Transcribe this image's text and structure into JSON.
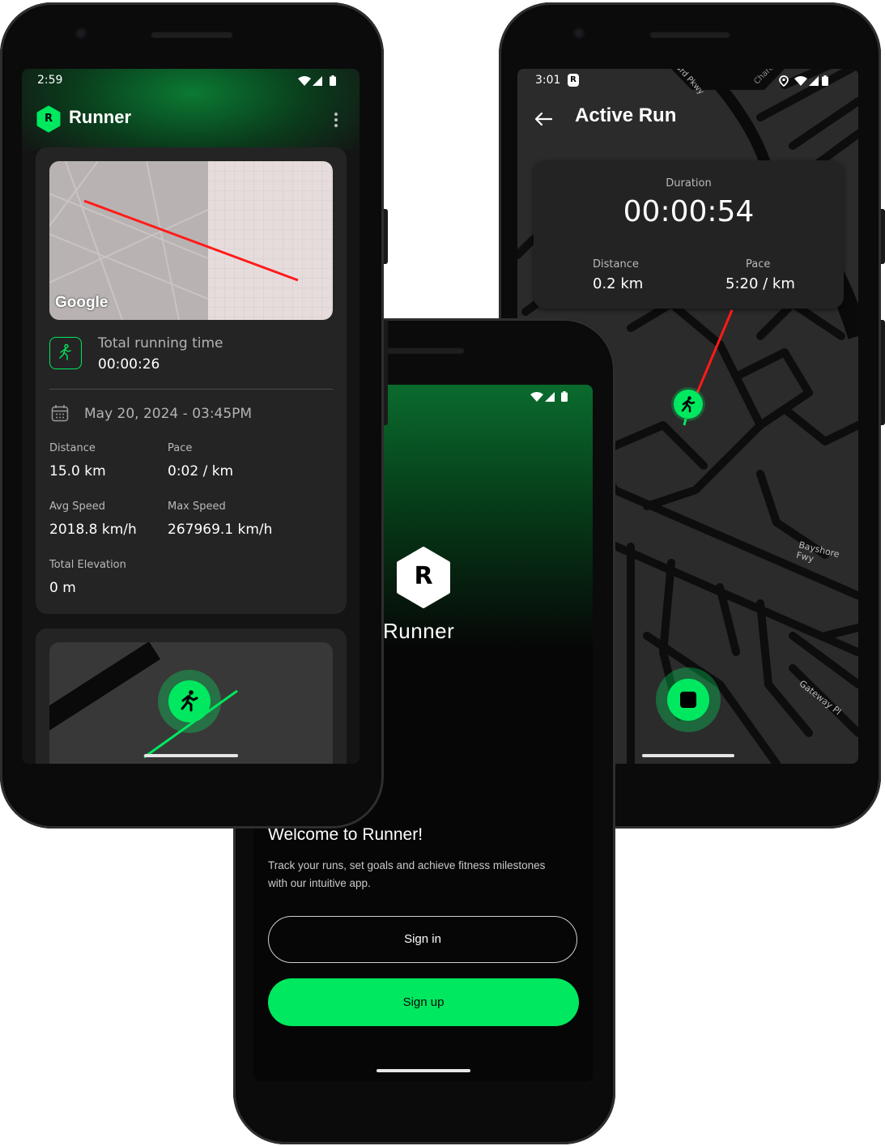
{
  "colors": {
    "accent": "#00e85f",
    "card": "#242424",
    "screen_bg": "#141414",
    "route": "#ff1a1a"
  },
  "home": {
    "status_time": "2:59",
    "app_title": "Runner",
    "logo_letter": "R",
    "map_provider": "Google",
    "running_time_label": "Total running time",
    "running_time_value": "00:00:26",
    "date_text": "May 20, 2024 - 03:45PM",
    "stats": [
      {
        "label": "Distance",
        "value": "15.0 km"
      },
      {
        "label": "Pace",
        "value": "0:02 / km"
      },
      {
        "label": "Avg Speed",
        "value": "2018.8 km/h"
      },
      {
        "label": "Max Speed",
        "value": "267969.1 km/h"
      },
      {
        "label": "Total Elevation",
        "value": "0 m"
      }
    ],
    "icons": [
      "more-vert-icon",
      "runner-icon",
      "calendar-icon"
    ]
  },
  "welcome": {
    "app_name": "Runner",
    "logo_letter": "R",
    "heading": "Welcome to Runner!",
    "description_line1": "Track your runs, set goals and achieve fitness milestones",
    "description_line2": "with our intuitive app.",
    "signin_label": "Sign in",
    "signup_label": "Sign up"
  },
  "active_run": {
    "status_time": "3:01",
    "status_badge": "R",
    "title": "Active Run",
    "duration_label": "Duration",
    "duration_value": "00:00:54",
    "distance_label": "Distance",
    "distance_value": "0.2 km",
    "pace_label": "Pace",
    "pace_value": "5:20 / km",
    "street_labels": [
      "Bayshore Fwy",
      "Gateway Pl",
      "ard Pkwy",
      "Charc"
    ],
    "icons": [
      "back-arrow-icon",
      "location-icon",
      "stop-icon",
      "runner-icon"
    ]
  }
}
